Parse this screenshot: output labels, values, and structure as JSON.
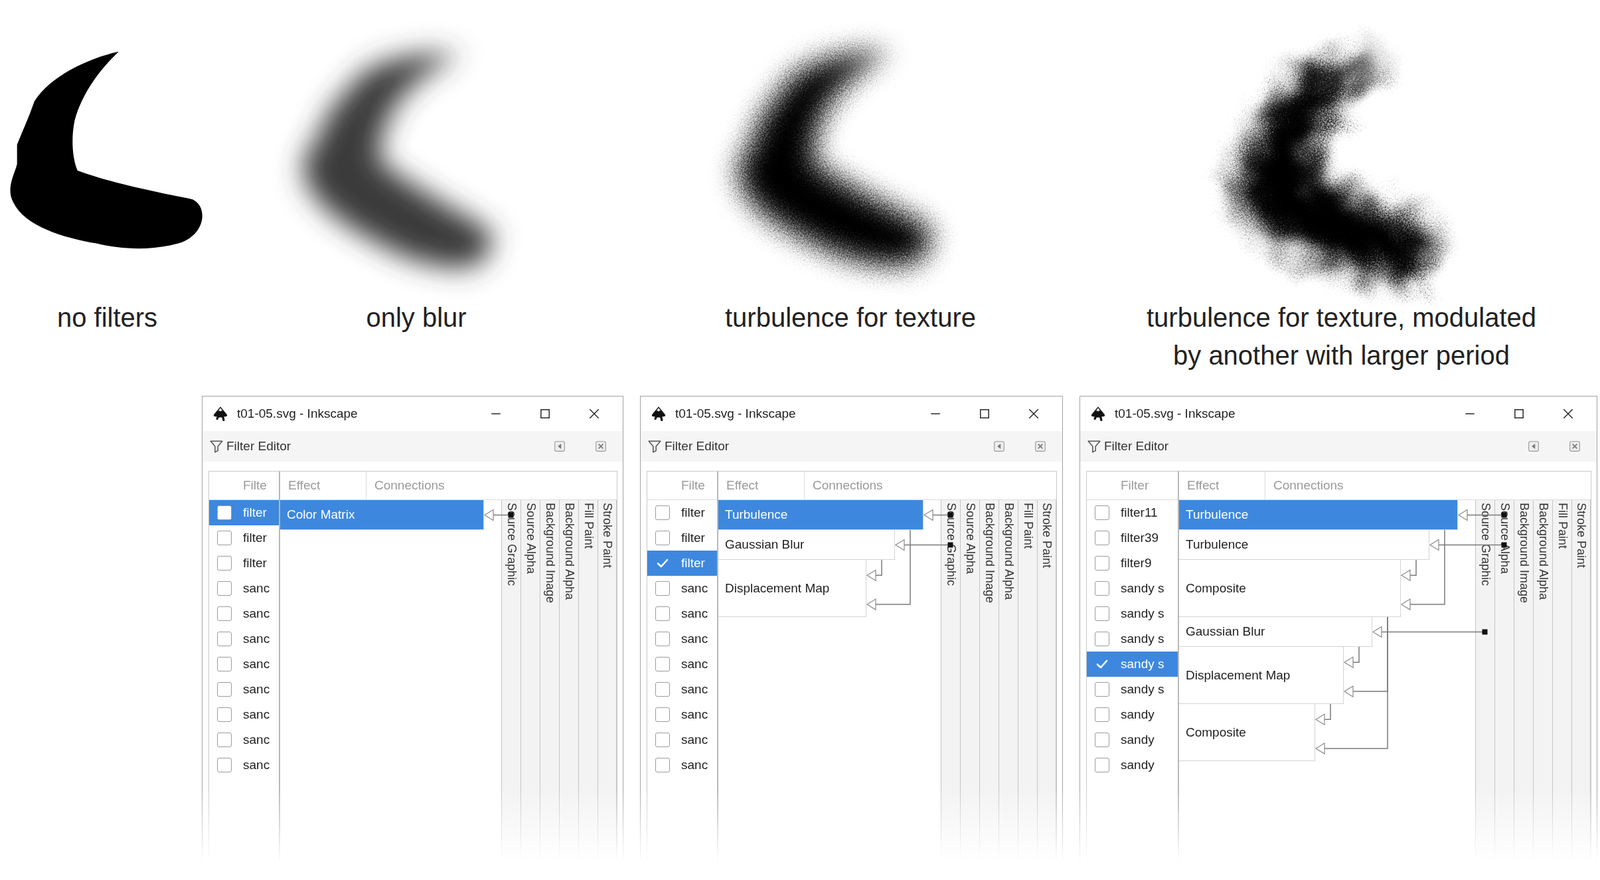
{
  "examples": [
    {
      "kind": "none",
      "caption_lines": [
        "no filters"
      ]
    },
    {
      "kind": "blur",
      "caption_lines": [
        "only blur"
      ]
    },
    {
      "kind": "turbulence",
      "caption_lines": [
        "turbulence for texture"
      ]
    },
    {
      "kind": "modulated",
      "caption_lines": [
        "turbulence for texture, modulated",
        "by another with larger period"
      ]
    }
  ],
  "windows": [
    {
      "title": "t01-05.svg - Inkscape",
      "panel_title": "Filter Editor",
      "filter_header": "Filte",
      "effect_header": "Effect",
      "connections_header": "Connections",
      "sources": [
        "Source Graphic",
        "Source Alpha",
        "Background Image",
        "Background Alpha",
        "Fill Paint",
        "Stroke Paint"
      ],
      "filters": [
        {
          "name": "filter",
          "checked": false,
          "selected": true
        },
        {
          "name": "filter",
          "checked": false,
          "selected": false
        },
        {
          "name": "filter",
          "checked": false,
          "selected": false
        },
        {
          "name": "sanc",
          "checked": false,
          "selected": false
        },
        {
          "name": "sanc",
          "checked": false,
          "selected": false
        },
        {
          "name": "sanc",
          "checked": false,
          "selected": false
        },
        {
          "name": "sanc",
          "checked": false,
          "selected": false
        },
        {
          "name": "sanc",
          "checked": false,
          "selected": false
        },
        {
          "name": "sanc",
          "checked": false,
          "selected": false
        },
        {
          "name": "sanc",
          "checked": false,
          "selected": false
        },
        {
          "name": "sanc",
          "checked": false,
          "selected": false
        }
      ],
      "effects": [
        {
          "name": "Color Matrix",
          "selected": true,
          "inputs": [
            "Source Graphic"
          ]
        }
      ]
    },
    {
      "title": "t01-05.svg - Inkscape",
      "panel_title": "Filter Editor",
      "filter_header": "Filte",
      "effect_header": "Effect",
      "connections_header": "Connections",
      "sources": [
        "Source Graphic",
        "Source Alpha",
        "Background Image",
        "Background Alpha",
        "Fill Paint",
        "Stroke Paint"
      ],
      "filters": [
        {
          "name": "filter",
          "checked": false,
          "selected": false
        },
        {
          "name": "filter",
          "checked": false,
          "selected": false
        },
        {
          "name": "filter",
          "checked": true,
          "selected": true
        },
        {
          "name": "sanc",
          "checked": false,
          "selected": false
        },
        {
          "name": "sanc",
          "checked": false,
          "selected": false
        },
        {
          "name": "sanc",
          "checked": false,
          "selected": false
        },
        {
          "name": "sanc",
          "checked": false,
          "selected": false
        },
        {
          "name": "sanc",
          "checked": false,
          "selected": false
        },
        {
          "name": "sanc",
          "checked": false,
          "selected": false
        },
        {
          "name": "sanc",
          "checked": false,
          "selected": false
        },
        {
          "name": "sanc",
          "checked": false,
          "selected": false
        }
      ],
      "effects": [
        {
          "name": "Turbulence",
          "selected": true,
          "inputs": [
            "Source Graphic"
          ]
        },
        {
          "name": "Gaussian Blur",
          "selected": false,
          "inputs": [
            "Source Graphic"
          ]
        },
        {
          "name": "Displacement Map",
          "selected": false,
          "inputs": [
            1,
            0
          ]
        }
      ]
    },
    {
      "title": "t01-05.svg - Inkscape",
      "panel_title": "Filter Editor",
      "filter_header": "Filter",
      "effect_header": "Effect",
      "connections_header": "Connections",
      "sources": [
        "Source Graphic",
        "Source Alpha",
        "Background Image",
        "Background Alpha",
        "Fill Paint",
        "Stroke Paint"
      ],
      "filters": [
        {
          "name": "filter11",
          "checked": false,
          "selected": false
        },
        {
          "name": "filter39",
          "checked": false,
          "selected": false
        },
        {
          "name": "filter9",
          "checked": false,
          "selected": false
        },
        {
          "name": "sandy s",
          "checked": false,
          "selected": false
        },
        {
          "name": "sandy s",
          "checked": false,
          "selected": false
        },
        {
          "name": "sandy s",
          "checked": false,
          "selected": false
        },
        {
          "name": "sandy s",
          "checked": true,
          "selected": true
        },
        {
          "name": "sandy s",
          "checked": false,
          "selected": false
        },
        {
          "name": "sandy",
          "checked": false,
          "selected": false
        },
        {
          "name": "sandy",
          "checked": false,
          "selected": false
        },
        {
          "name": "sandy",
          "checked": false,
          "selected": false
        }
      ],
      "effects": [
        {
          "name": "Turbulence",
          "selected": true,
          "inputs": [
            "Source Alpha"
          ]
        },
        {
          "name": "Turbulence",
          "selected": false,
          "inputs": [
            "Source Alpha"
          ]
        },
        {
          "name": "Composite",
          "selected": false,
          "inputs": [
            1,
            0
          ]
        },
        {
          "name": "Gaussian Blur",
          "selected": false,
          "inputs": [
            "Source Graphic"
          ]
        },
        {
          "name": "Displacement Map",
          "selected": false,
          "inputs": [
            3,
            2
          ]
        },
        {
          "name": "Composite",
          "selected": false,
          "inputs": [
            4,
            2
          ]
        }
      ]
    }
  ]
}
